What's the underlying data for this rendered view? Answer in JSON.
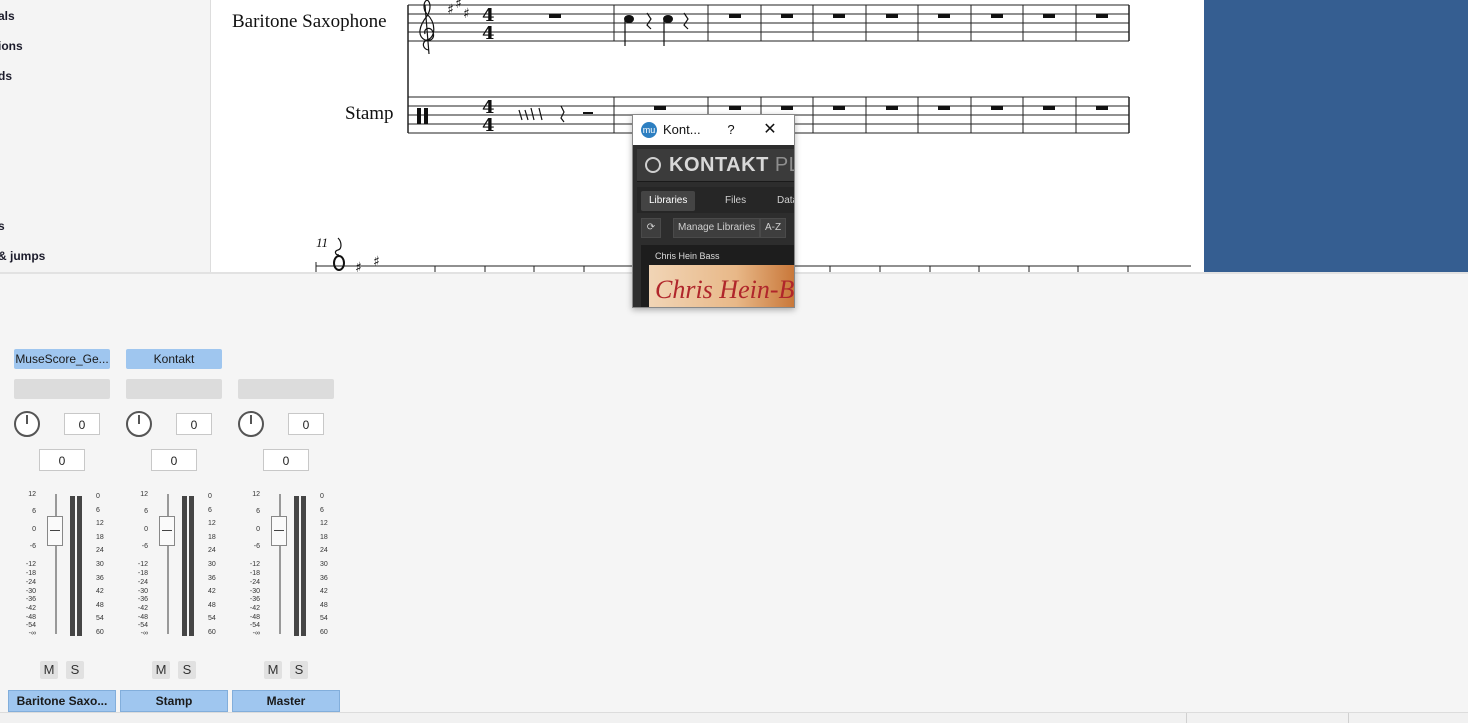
{
  "palette": {
    "items": [
      "als",
      "ions",
      "ds",
      "s",
      "& jumps"
    ]
  },
  "score": {
    "instruments": [
      "Baritone Saxophone",
      "Stamp"
    ],
    "measure_number": "11"
  },
  "kontakt": {
    "title": "Kont...",
    "help": "?",
    "close": "✕",
    "logo_text": "mu",
    "brand": "KONTAKT",
    "brand_suffix": "PL",
    "tabs": [
      "Libraries",
      "Files",
      "Data"
    ],
    "active_tab": "Libraries",
    "toolbar": {
      "refresh": "⟳",
      "manage": "Manage Libraries",
      "sort": "A-Z"
    },
    "library": {
      "name": "Chris Hein Bass",
      "art_text": "Chris Hein-B"
    }
  },
  "mixer": {
    "strips": [
      {
        "top_label": "MuseScore_Ge...",
        "pan": "0",
        "volume": "0",
        "mute": "M",
        "solo": "S",
        "name": "Baritone Saxo..."
      },
      {
        "top_label": "Kontakt",
        "pan": "0",
        "volume": "0",
        "mute": "M",
        "solo": "S",
        "name": "Stamp"
      },
      {
        "top_label": "",
        "pan": "0",
        "volume": "0",
        "mute": "M",
        "solo": "S",
        "name": "Master"
      }
    ],
    "fader_scale": [
      "12",
      "6",
      "0",
      "-6",
      "-12",
      "-18",
      "-24",
      "-30",
      "-36",
      "-42",
      "-48",
      "-54",
      "-∞"
    ],
    "meter_scale": [
      "0",
      "6",
      "12",
      "18",
      "24",
      "30",
      "36",
      "42",
      "48",
      "54",
      "60"
    ]
  },
  "colors": {
    "accent_panel": "#355e91",
    "strip_label": "#9fc6ef"
  }
}
